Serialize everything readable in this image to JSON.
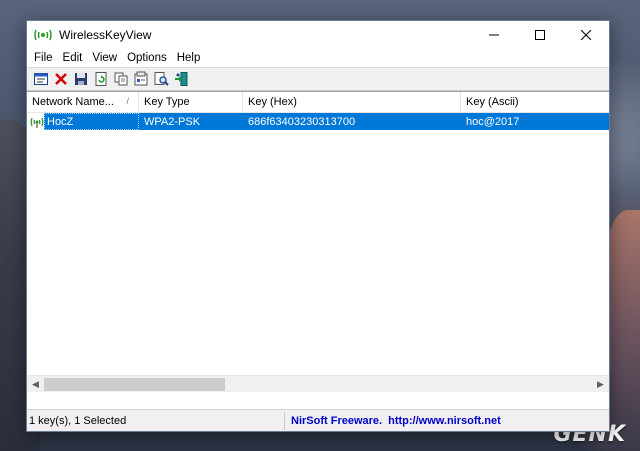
{
  "window": {
    "title": "WirelessKeyView",
    "minimize_glyph": "—",
    "maximize_glyph": "☐",
    "close_glyph": "✕"
  },
  "menu": [
    "File",
    "Edit",
    "View",
    "Options",
    "Help"
  ],
  "toolbar": {
    "icons": [
      "properties-icon",
      "delete-icon",
      "save-icon",
      "refresh-icon",
      "copy-icon",
      "report-icon",
      "find-icon",
      "exit-icon"
    ]
  },
  "table": {
    "columns": [
      {
        "label": "Network Name...",
        "sort": "ascending"
      },
      {
        "label": "Key Type"
      },
      {
        "label": "Key (Hex)"
      },
      {
        "label": "Key (Ascii)"
      }
    ],
    "sort_glyph": "/",
    "rows": [
      {
        "network": "HocZ",
        "key_type": "WPA2-PSK",
        "key_hex": "686f63403230313700",
        "key_ascii": "hoc@2017",
        "selected": true
      }
    ]
  },
  "scrollbar": {
    "left_arrow": "◀",
    "right_arrow": "▶"
  },
  "status": {
    "left": "1 key(s), 1 Selected",
    "freeware": "NirSoft Freeware.",
    "url": "http://www.nirsoft.net"
  },
  "watermark": "GENK",
  "colors": {
    "selection": "#0078d7",
    "status_link": "#0000cc",
    "app_icon": "#2f9a2f"
  }
}
